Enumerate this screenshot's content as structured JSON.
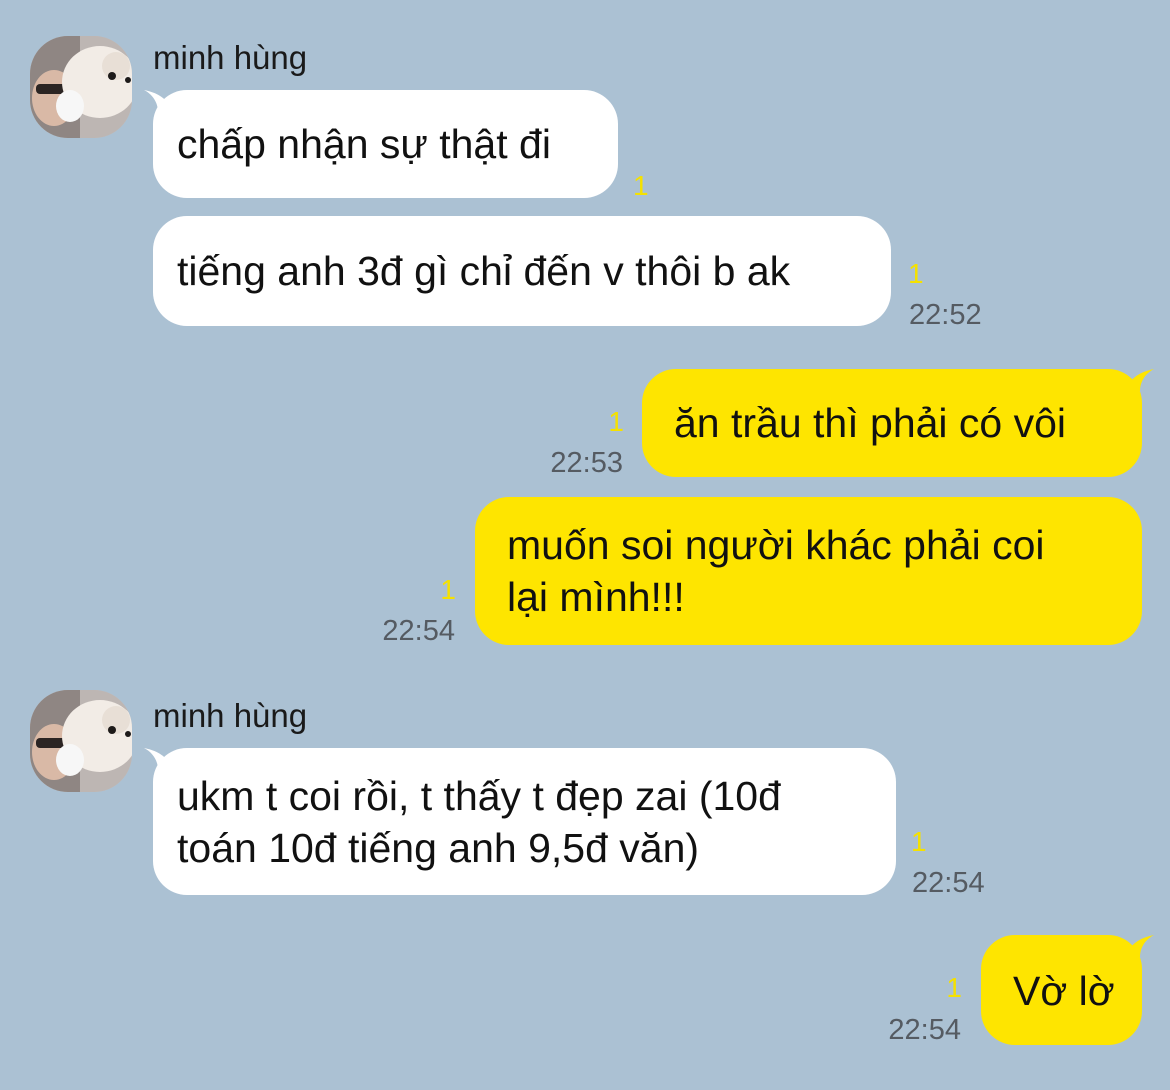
{
  "colors": {
    "background": "#abc1d3",
    "incoming_bubble": "#ffffff",
    "outgoing_bubble": "#fee500",
    "unread_count": "#f5e100",
    "timestamp": "#555b62"
  },
  "groups": [
    {
      "sender": "minh hùng",
      "avatar_icon": "user-avatar-with-dog-photo",
      "messages": [
        {
          "text": "chấp nhận sự thật đi",
          "unread": "1"
        },
        {
          "text": "tiếng anh 3đ gì chỉ đến v thôi b ak",
          "unread": "1",
          "time": "22:52"
        }
      ]
    },
    {
      "sender": "me",
      "messages": [
        {
          "text": "ăn trầu thì phải có vôi",
          "unread": "1",
          "time": "22:53"
        },
        {
          "text": "muốn soi người khác phải coi\nlại mình!!!",
          "unread": "1",
          "time": "22:54"
        }
      ]
    },
    {
      "sender": "minh hùng",
      "avatar_icon": "user-avatar-with-dog-photo",
      "messages": [
        {
          "text": "ukm t coi rồi, t thấy t đẹp zai (10đ\ntoán 10đ tiếng anh 9,5đ văn)",
          "unread": "1",
          "time": "22:54"
        }
      ]
    },
    {
      "sender": "me",
      "messages": [
        {
          "text": "Vờ lờ",
          "unread": "1",
          "time": "22:54"
        }
      ]
    }
  ]
}
